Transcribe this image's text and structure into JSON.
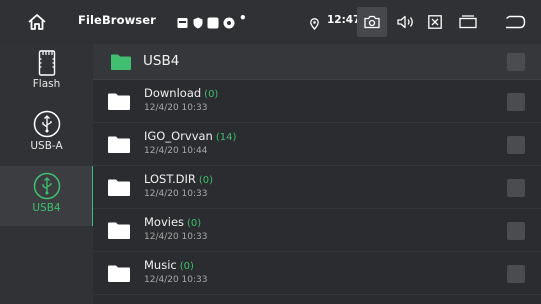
{
  "statusbar": {
    "app_title": "FileBrowser",
    "time": "12:47",
    "dot": "•"
  },
  "sidebar": {
    "items": [
      {
        "label": "Flash",
        "icon": "sd-card-icon"
      },
      {
        "label": "USB-A",
        "icon": "usb-icon"
      },
      {
        "label": "USB4",
        "icon": "usb-icon",
        "active": true
      }
    ]
  },
  "main": {
    "current_folder": "USB4",
    "rows": [
      {
        "name": "Download",
        "count": "(0)",
        "date": "12/4/20 10:33"
      },
      {
        "name": "IGO_Orvvan",
        "count": "(14)",
        "date": "12/4/20 10:44"
      },
      {
        "name": "LOST.DIR",
        "count": "(0)",
        "date": "12/4/20 10:33"
      },
      {
        "name": "Movies",
        "count": "(0)",
        "date": "12/4/20 10:33"
      },
      {
        "name": "Music",
        "count": "(0)",
        "date": "12/4/20 10:33"
      }
    ]
  },
  "colors": {
    "accent": "#3fbf6f",
    "background": "#2a2c2f"
  }
}
